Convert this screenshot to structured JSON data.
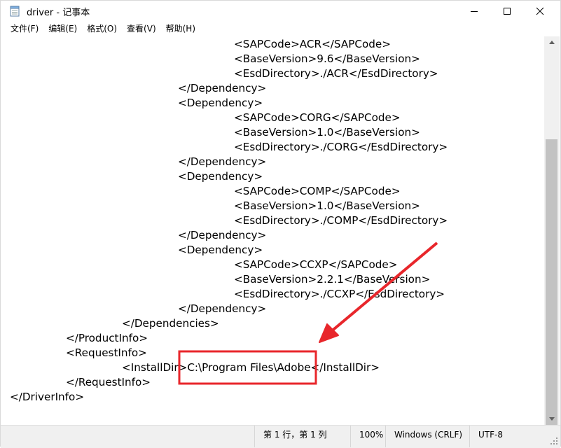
{
  "window": {
    "title": "driver - 记事本"
  },
  "menu": [
    {
      "label": "文件(F)"
    },
    {
      "label": "编辑(E)"
    },
    {
      "label": "格式(O)"
    },
    {
      "label": "查看(V)"
    },
    {
      "label": "帮助(H)"
    }
  ],
  "editor": {
    "lines": [
      "<SAPCode>ACR</SAPCode>",
      "<BaseVersion>9.6</BaseVersion>",
      "<EsdDirectory>./ACR</EsdDirectory>",
      "</Dependency>",
      "<Dependency>",
      "<SAPCode>CORG</SAPCode>",
      "<BaseVersion>1.0</BaseVersion>",
      "<EsdDirectory>./CORG</EsdDirectory>",
      "</Dependency>",
      "<Dependency>",
      "<SAPCode>COMP</SAPCode>",
      "<BaseVersion>1.0</BaseVersion>",
      "<EsdDirectory>./COMP</EsdDirectory>",
      "</Dependency>",
      "<Dependency>",
      "<SAPCode>CCXP</SAPCode>",
      "<BaseVersion>2.2.1</BaseVersion>",
      "<EsdDirectory>./CCXP</EsdDirectory>",
      "</Dependency>",
      "</Dependencies>",
      "</ProductInfo>",
      "<RequestInfo>",
      "<InstallDir>C:\\Program Files\\Adobe</InstallDir>",
      "</RequestInfo>",
      "</DriverInfo>"
    ]
  },
  "annotation": {
    "highlighted_text": "C:\\Program Files\\Adobe",
    "color": "#e8262b"
  },
  "status": {
    "position": "第 1 行，第 1 列",
    "zoom": "100%",
    "line_ending": "Windows (CRLF)",
    "encoding": "UTF-8"
  }
}
